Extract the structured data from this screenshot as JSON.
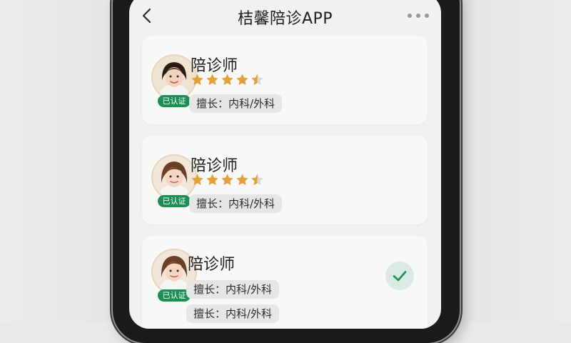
{
  "app": {
    "title": "桔馨陪诊APP"
  },
  "colors": {
    "accent": "#1c8f55",
    "star": "#e3a13a",
    "check_bg": "#d9ebe2"
  },
  "icons": {
    "back": "back-chevron-icon",
    "more": "more-dots-icon",
    "star": "star-icon",
    "check": "check-icon"
  },
  "cards": [
    {
      "name": "陪诊师",
      "badge": "已认证",
      "rating": 4.5,
      "specialty": "擅长：内科/外科"
    },
    {
      "name": "陪诊师",
      "badge": "已认证",
      "rating": 4.5,
      "specialty": "擅长：内科/外科"
    },
    {
      "name": "陪诊师",
      "badge": "已认证",
      "specialty": "擅长：内科/外科",
      "specialty_2": "擅长：内科/外科",
      "selected": true
    }
  ]
}
